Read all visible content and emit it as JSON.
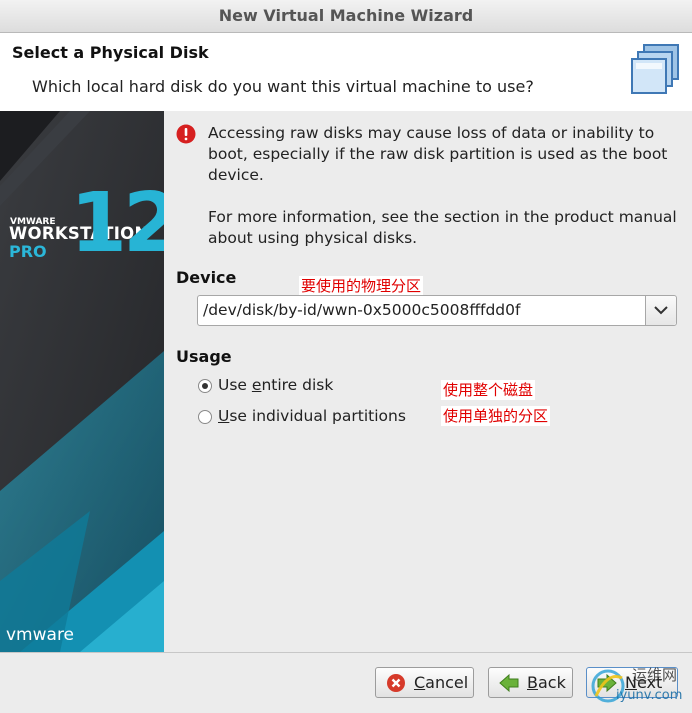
{
  "window": {
    "title": "New Virtual Machine Wizard"
  },
  "header": {
    "title": "Select a Physical Disk",
    "subtitle": "Which local hard disk do you want this virtual machine to use?"
  },
  "sidebar": {
    "brand_small": "VMWARE",
    "product": "WORKSTATION",
    "edition": "PRO",
    "version": "12",
    "vendor_logo": "vmware"
  },
  "warning": {
    "icon": "error-icon",
    "text": "Accessing raw disks may cause loss of data or inability to boot, especially if the raw disk partition is used as the boot device.",
    "more_info": "For more information, see the section in the product manual about using physical disks."
  },
  "device": {
    "label": "Device",
    "selected": "/dev/disk/by-id/wwn-0x5000c5008fffdd0f",
    "annotation": "要使用的物理分区"
  },
  "usage": {
    "label": "Usage",
    "options": [
      {
        "prefix": "Use ",
        "mnemonic": "e",
        "suffix": "ntire disk",
        "selected": true,
        "annotation": "使用整个磁盘"
      },
      {
        "prefix": "",
        "mnemonic": "U",
        "suffix": "se individual partitions",
        "selected": false,
        "annotation": "使用单独的分区"
      }
    ]
  },
  "buttons": {
    "cancel": {
      "mnemonic": "C",
      "rest": "ancel"
    },
    "back": {
      "mnemonic": "B",
      "rest": "ack"
    },
    "next": {
      "mnemonic": "N",
      "rest": "ext"
    }
  },
  "watermark": {
    "line1": "运维网",
    "line2": "iyunv.com"
  },
  "colors": {
    "annotation": "#e00000",
    "sidebar_bg": "#2d2f33",
    "sidebar_accent": "#1aa9c9",
    "panel_bg": "#ececec"
  }
}
